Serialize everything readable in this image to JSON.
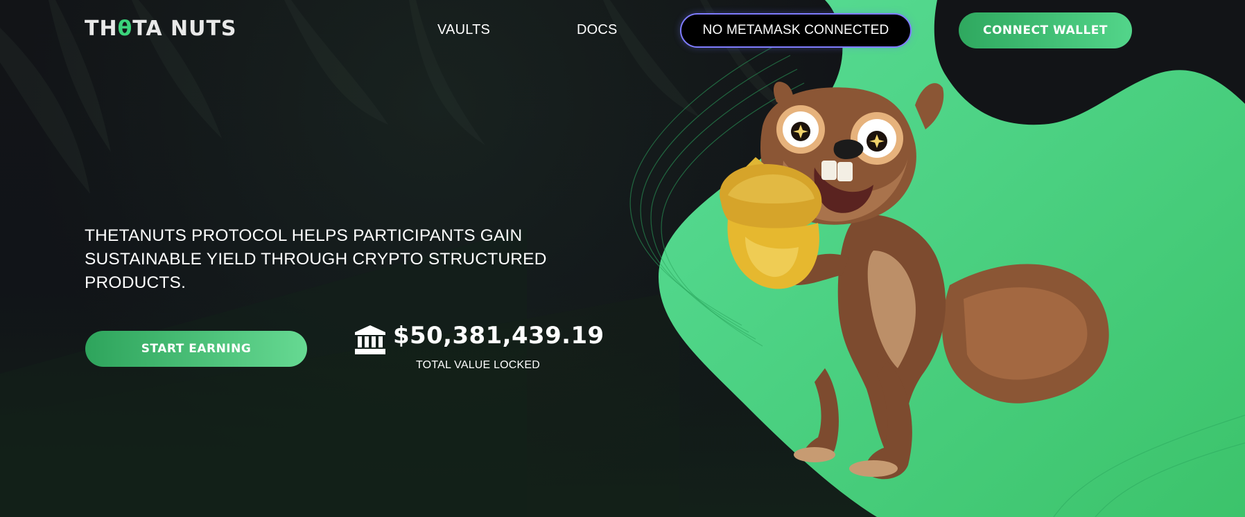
{
  "header": {
    "logo_text_prefix": "TH",
    "logo_text_theta": "θ",
    "logo_text_suffix": "TA NUTS",
    "nav": [
      {
        "label": "VAULTS"
      },
      {
        "label": "DOCS"
      }
    ],
    "metamask_status": "NO METAMASK CONNECTED",
    "connect_wallet_label": "CONNECT WALLET"
  },
  "hero": {
    "headline": "THETANUTS PROTOCOL HELPS PARTICIPANTS GAIN SUSTAINABLE YIELD THROUGH CRYPTO STRUCTURED PRODUCTS.",
    "cta_label": "START EARNING",
    "tvl_value": "$50,381,439.19",
    "tvl_label": "TOTAL VALUE LOCKED",
    "tvl_icon": "bank-icon"
  },
  "colors": {
    "background": "#121417",
    "accent_green": "#4cd58a",
    "button_green_start": "#2ea45c",
    "button_green_end": "#66d992",
    "metamask_border": "#7f7cff",
    "text": "#ffffff"
  }
}
